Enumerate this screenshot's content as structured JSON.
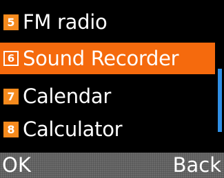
{
  "menu": {
    "items": [
      {
        "number": "5",
        "label": "FM radio",
        "selected": false
      },
      {
        "number": "6",
        "label": "Sound Recorder",
        "selected": true
      },
      {
        "number": "7",
        "label": "Calendar",
        "selected": false
      },
      {
        "number": "8",
        "label": "Calculator",
        "selected": false
      }
    ]
  },
  "softkeys": {
    "left_label": "OK",
    "right_label": "Back"
  },
  "colors": {
    "selection": "#f56a0d",
    "badge": "#f58a1d",
    "scrollbar": "#2f8fe6",
    "softkey_bar": "#6b6b6b"
  }
}
